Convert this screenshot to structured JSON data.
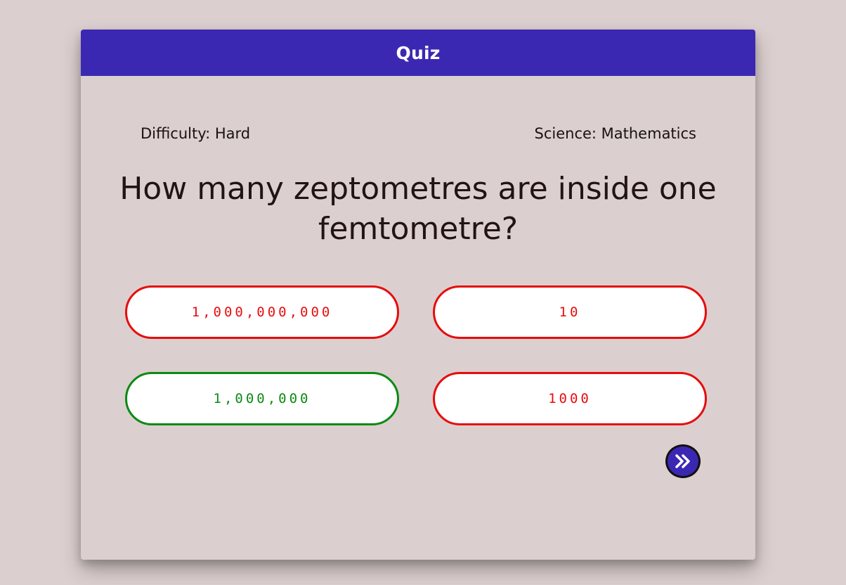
{
  "header": {
    "title": "Quiz"
  },
  "meta": {
    "difficulty": "Difficulty: Hard",
    "category": "Science: Mathematics"
  },
  "question": {
    "text": "How many zeptometres are inside one femtometre?"
  },
  "answers": [
    {
      "label": "1,000,000,000",
      "state": "incorrect"
    },
    {
      "label": "10",
      "state": "incorrect"
    },
    {
      "label": "1,000,000",
      "state": "correct"
    },
    {
      "label": "1000",
      "state": "incorrect"
    }
  ],
  "next_button": {
    "icon": "double-chevron-right-icon"
  },
  "colors": {
    "background": "#dccfcf",
    "accent": "#3b28b2",
    "incorrect": "#e60d0d",
    "correct": "#0a8a12"
  }
}
